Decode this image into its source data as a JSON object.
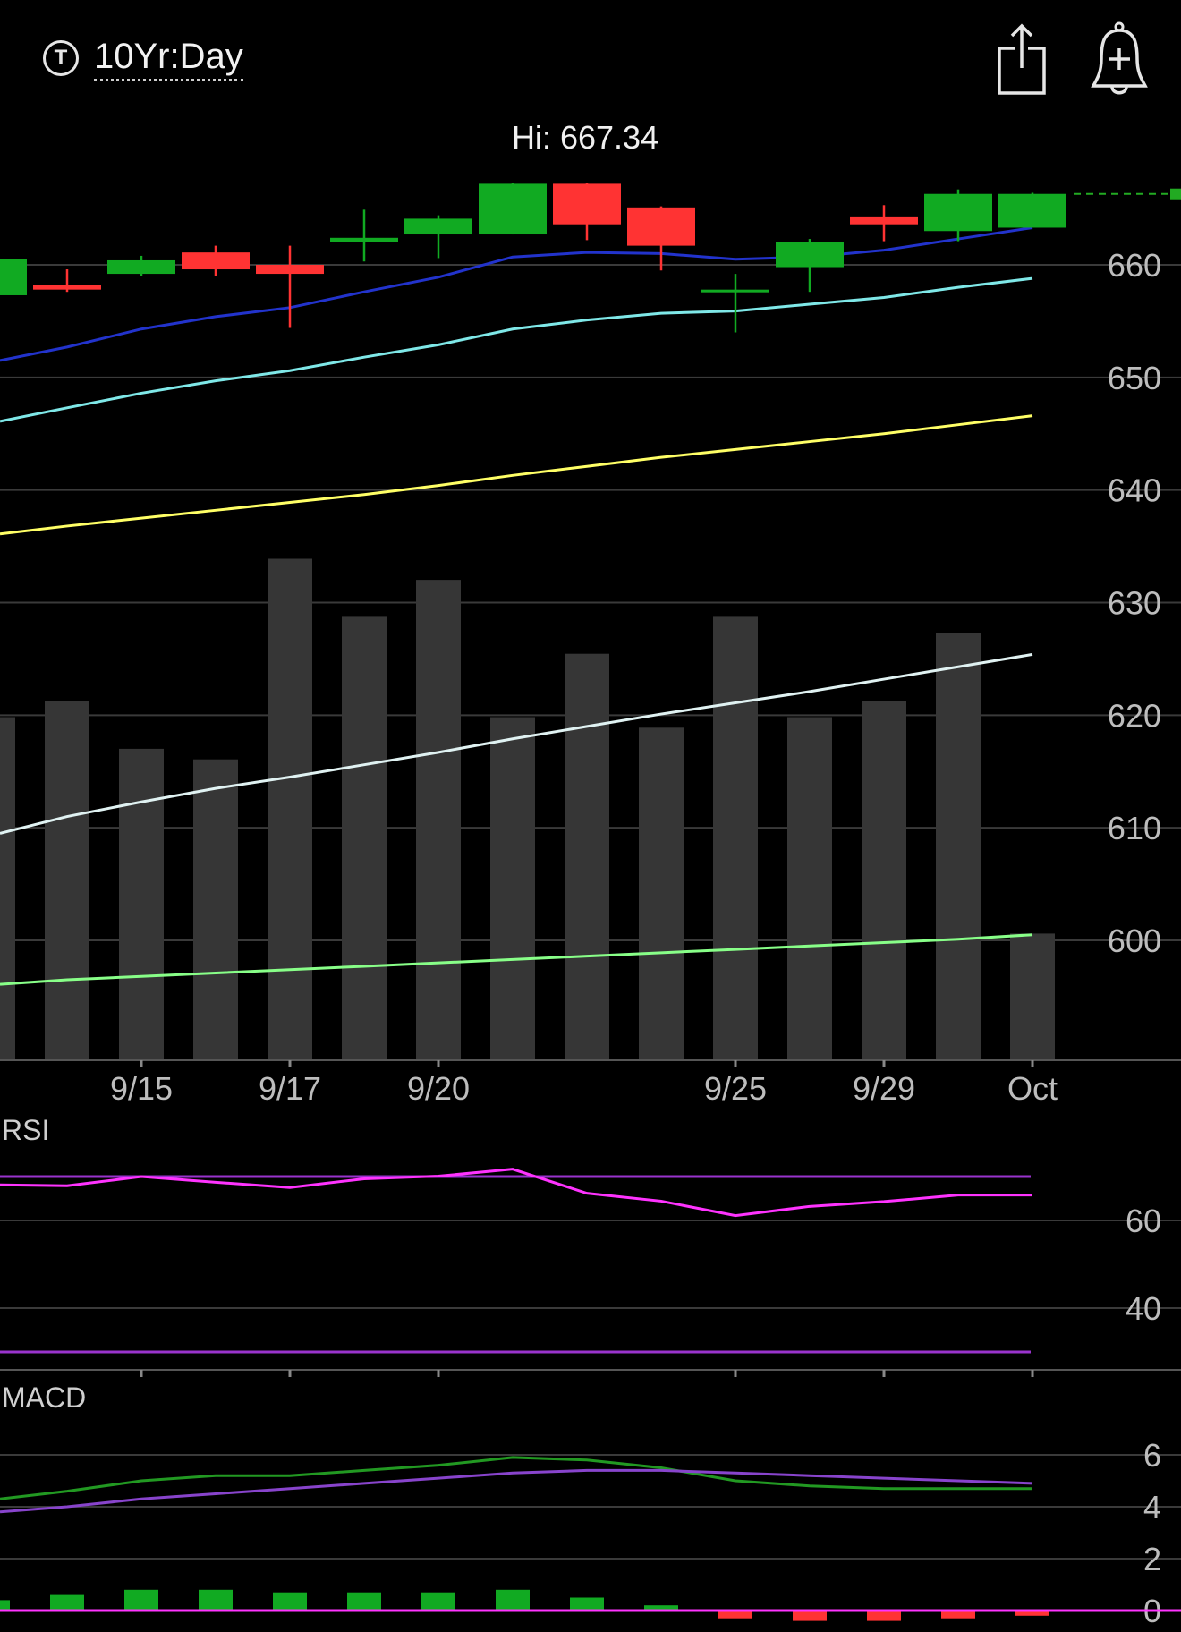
{
  "header": {
    "range_label": "10Yr:Day",
    "range_icon_letter": "T",
    "share_icon": "share-icon",
    "alert_icon": "add-alert-bell-icon"
  },
  "chart_data": [
    {
      "type": "candlestick",
      "hi_label": "Hi: 667.34",
      "ylim": [
        590,
        672
      ],
      "yticks": [
        600,
        610,
        620,
        630,
        640,
        650,
        660
      ],
      "xticks": [
        "9/15",
        "9/17",
        "9/20",
        "9/25",
        "9/29",
        "Oct"
      ],
      "dates_index": [
        0,
        1,
        2,
        3,
        4,
        5,
        6,
        7,
        8,
        9,
        10,
        11,
        12,
        13,
        14
      ],
      "xtick_index": [
        2,
        4,
        6,
        10,
        12,
        14
      ],
      "candles": [
        {
          "o": 657.3,
          "h": 657.3,
          "l": 653.9,
          "c": 660.5,
          "up": true
        },
        {
          "o": 658.2,
          "h": 659.6,
          "l": 657.6,
          "c": 657.8,
          "up": false
        },
        {
          "o": 659.2,
          "h": 660.8,
          "l": 659.0,
          "c": 660.4,
          "up": true
        },
        {
          "o": 661.1,
          "h": 661.7,
          "l": 659.0,
          "c": 659.6,
          "up": false
        },
        {
          "o": 660.0,
          "h": 661.7,
          "l": 654.4,
          "c": 659.2,
          "up": false
        },
        {
          "o": 662.0,
          "h": 664.9,
          "l": 660.3,
          "c": 662.4,
          "up": true
        },
        {
          "o": 662.7,
          "h": 664.4,
          "l": 660.6,
          "c": 664.1,
          "up": true
        },
        {
          "o": 662.7,
          "h": 667.3,
          "l": 662.7,
          "c": 667.2,
          "up": true
        },
        {
          "o": 667.2,
          "h": 667.3,
          "l": 662.2,
          "c": 663.6,
          "up": false
        },
        {
          "o": 665.1,
          "h": 665.2,
          "l": 659.5,
          "c": 661.7,
          "up": false
        },
        {
          "o": 657.8,
          "h": 659.2,
          "l": 654.0,
          "c": 657.8,
          "up": true
        },
        {
          "o": 659.8,
          "h": 662.3,
          "l": 657.6,
          "c": 662.0,
          "up": true
        },
        {
          "o": 664.3,
          "h": 665.3,
          "l": 662.1,
          "c": 663.6,
          "up": false
        },
        {
          "o": 663.0,
          "h": 666.7,
          "l": 662.1,
          "c": 666.3,
          "up": true
        },
        {
          "o": 663.3,
          "h": 666.4,
          "l": 663.3,
          "c": 666.3,
          "up": true
        }
      ],
      "last_price": 666.3,
      "volume_rel": [
        0.65,
        0.68,
        0.59,
        0.57,
        0.95,
        0.84,
        0.91,
        0.65,
        0.77,
        0.63,
        0.84,
        0.65,
        0.68,
        0.81,
        0.24
      ],
      "ma_series": [
        {
          "color": "#2233cc",
          "values": [
            651.5,
            652.7,
            654.3,
            655.4,
            656.2,
            657.6,
            658.9,
            660.7,
            661.1,
            661.0,
            660.5,
            660.7,
            661.3,
            662.3,
            663.3
          ]
        },
        {
          "color": "#7fe8e8",
          "values": [
            646.1,
            647.3,
            648.6,
            649.7,
            650.6,
            651.8,
            652.9,
            654.3,
            655.1,
            655.7,
            655.9,
            656.5,
            657.1,
            658.0,
            658.8
          ]
        },
        {
          "color": "#ffff66",
          "values": [
            636.1,
            636.8,
            637.5,
            638.2,
            638.9,
            639.6,
            640.4,
            641.3,
            642.1,
            642.9,
            643.6,
            644.3,
            645.0,
            645.8,
            646.6
          ]
        },
        {
          "color": "#e0f2f2",
          "values": [
            609.5,
            611.0,
            612.3,
            613.5,
            614.5,
            615.6,
            616.7,
            617.9,
            619.0,
            620.1,
            621.1,
            622.1,
            623.2,
            624.3,
            625.4
          ]
        },
        {
          "color": "#88ff88",
          "values": [
            596.1,
            596.5,
            596.8,
            597.1,
            597.4,
            597.7,
            598.0,
            598.3,
            598.6,
            598.9,
            599.2,
            599.5,
            599.8,
            600.1,
            600.5
          ]
        }
      ]
    },
    {
      "type": "line",
      "title": "RSI",
      "ylim": [
        16,
        80
      ],
      "yticks": [
        40,
        60
      ],
      "overbought": 70,
      "oversold": 30,
      "series": [
        {
          "color": "#ff33ff",
          "values": [
            68.1,
            67.9,
            70.0,
            68.7,
            67.5,
            69.5,
            70.1,
            71.7,
            66.2,
            64.4,
            61.1,
            63.2,
            64.3,
            65.8,
            65.8
          ]
        }
      ]
    },
    {
      "type": "line",
      "title": "MACD",
      "ylim": [
        -0.5,
        7.5
      ],
      "yticks": [
        0,
        2,
        4,
        6
      ],
      "series": [
        {
          "color": "#229922",
          "values": [
            4.3,
            4.6,
            5.0,
            5.2,
            5.2,
            5.4,
            5.6,
            5.9,
            5.8,
            5.5,
            5.0,
            4.8,
            4.7,
            4.7,
            4.7
          ]
        },
        {
          "color": "#8844cc",
          "values": [
            3.8,
            4.0,
            4.3,
            4.5,
            4.7,
            4.9,
            5.1,
            5.3,
            5.4,
            5.4,
            5.3,
            5.2,
            5.1,
            5.0,
            4.9
          ]
        }
      ],
      "histogram": [
        0.4,
        0.6,
        0.8,
        0.8,
        0.7,
        0.7,
        0.7,
        0.8,
        0.5,
        0.2,
        -0.3,
        -0.4,
        -0.4,
        -0.3,
        -0.2
      ]
    }
  ]
}
